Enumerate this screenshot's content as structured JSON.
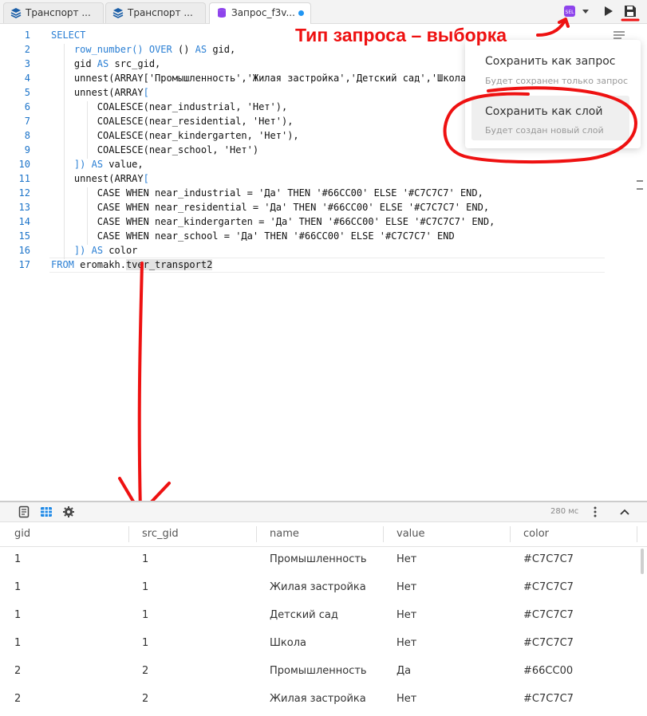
{
  "tabs": [
    {
      "label": "Транспорт ...",
      "icon": "layers-icon"
    },
    {
      "label": "Транспорт ...",
      "icon": "layers-icon"
    },
    {
      "label": "Запрос_f3v...",
      "icon": "database-icon",
      "active": true,
      "unsaved": true
    }
  ],
  "toolbar": {
    "query_type_icon": "sql-select-icon",
    "dropdown_icon": "caret-down-icon",
    "run_icon": "play-icon",
    "save_icon": "save-icon"
  },
  "editor": {
    "lines": [
      {
        "n": "1",
        "text": "SELECT"
      },
      {
        "n": "2",
        "text": "    row_number() OVER () AS gid,"
      },
      {
        "n": "3",
        "text": "    gid AS src_gid,"
      },
      {
        "n": "4",
        "text": "    unnest(ARRAY['Промышленность','Жилая застройка','Детский сад','Школа"
      },
      {
        "n": "5",
        "text": "    unnest(ARRAY["
      },
      {
        "n": "6",
        "text": "        COALESCE(near_industrial, 'Нет'),"
      },
      {
        "n": "7",
        "text": "        COALESCE(near_residential, 'Нет'),"
      },
      {
        "n": "8",
        "text": "        COALESCE(near_kindergarten, 'Нет'),"
      },
      {
        "n": "9",
        "text": "        COALESCE(near_school, 'Нет')"
      },
      {
        "n": "10",
        "text": "    ]) AS value,"
      },
      {
        "n": "11",
        "text": "    unnest(ARRAY["
      },
      {
        "n": "12",
        "text": "        CASE WHEN near_industrial = 'Да' THEN '#66CC00' ELSE '#C7C7C7' END,"
      },
      {
        "n": "13",
        "text": "        CASE WHEN near_residential = 'Да' THEN '#66CC00' ELSE '#C7C7C7' END,"
      },
      {
        "n": "14",
        "text": "        CASE WHEN near_kindergarten = 'Да' THEN '#66CC00' ELSE '#C7C7C7' END,"
      },
      {
        "n": "15",
        "text": "        CASE WHEN near_school = 'Да' THEN '#66CC00' ELSE '#C7C7C7' END"
      },
      {
        "n": "16",
        "text": "    ]) AS color"
      },
      {
        "n": "17",
        "text": "FROM eromakh.tver_transport2"
      }
    ]
  },
  "save_menu": {
    "items": [
      {
        "title": "Сохранить как запрос",
        "subtitle": "Будет сохранен только запрос"
      },
      {
        "title": "Сохранить как слой",
        "subtitle": "Будет создан новый слой"
      }
    ]
  },
  "annotation": {
    "text": "Тип запроса – выборка",
    "color": "#ee1111"
  },
  "results": {
    "timing": "280 мс",
    "columns": [
      "gid",
      "src_gid",
      "name",
      "value",
      "color"
    ],
    "rows": [
      [
        "1",
        "1",
        "Промышленность",
        "Нет",
        "#C7C7C7"
      ],
      [
        "1",
        "1",
        "Жилая застройка",
        "Нет",
        "#C7C7C7"
      ],
      [
        "1",
        "1",
        "Детский сад",
        "Нет",
        "#C7C7C7"
      ],
      [
        "1",
        "1",
        "Школа",
        "Нет",
        "#C7C7C7"
      ],
      [
        "2",
        "2",
        "Промышленность",
        "Да",
        "#66CC00"
      ],
      [
        "2",
        "2",
        "Жилая застройка",
        "Нет",
        "#C7C7C7"
      ]
    ]
  },
  "colors": {
    "keyword": "#2a7fd4",
    "line_number": "#1b73c9",
    "unsaved_dot": "#2196f3",
    "accent_purple": "#8e44ec",
    "table_view_icon": "#1e88e5"
  }
}
